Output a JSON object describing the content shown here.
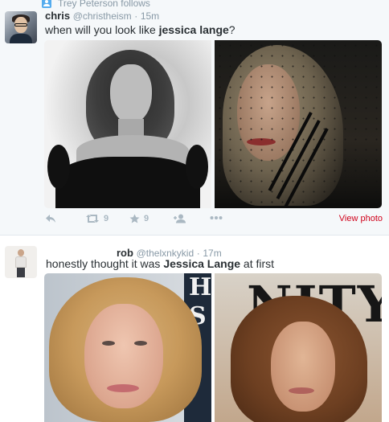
{
  "tweet1": {
    "context": "Trey Peterson follows",
    "fullname": "chris",
    "username": "@christheism",
    "dot": "·",
    "time": "15m",
    "text_before": "when will you look like ",
    "text_bold": "jessica lange",
    "text_after": "?",
    "actions": {
      "reply_icon": "reply-icon",
      "retweet_icon": "retweet-icon",
      "retweet_count": "9",
      "like_icon": "star-icon",
      "like_count": "9",
      "follow_icon": "follow-icon",
      "more_icon": "more-icon",
      "view_photo": "View photo"
    },
    "colors": {
      "icon": "#aab8c2",
      "view_photo": "#d0021b"
    }
  },
  "tweet2": {
    "fullname": "rob",
    "username": "@thelxnkykid",
    "dot": "·",
    "time": "17m",
    "text_before": "honestly thought it was ",
    "text_bold": "Jessica Lange",
    "text_after": " at first",
    "magazine_masthead": "NITY FA",
    "side_letters": [
      "H",
      "S"
    ]
  },
  "colors": {
    "secondary_text": "#8899a6",
    "primary_text": "#292f33",
    "tweet1_background": "#f5f8fa",
    "context_icon": "#55acee"
  }
}
